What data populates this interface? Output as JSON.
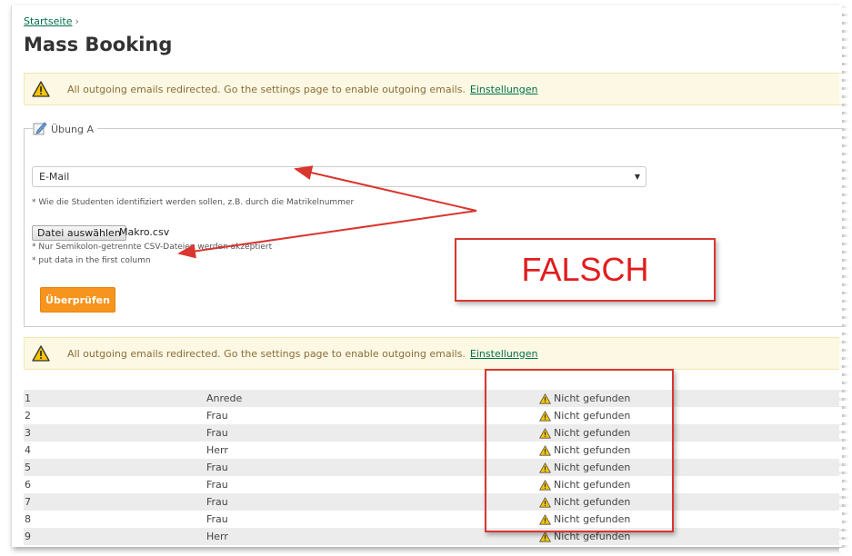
{
  "breadcrumb": {
    "home_label": "Startseite",
    "separator": "›"
  },
  "page_title": "Mass Booking",
  "alert": {
    "message": "All outgoing emails redirected. Go the settings page to enable outgoing emails.",
    "link_label": "Einstellungen"
  },
  "form": {
    "legend": "Übung A",
    "identifier_select": {
      "value": "E-Mail"
    },
    "identifier_hint": "* Wie die Studenten identifiziert werden sollen, z.B. durch die Matrikelnummer",
    "file_button_label": "Datei auswählen",
    "file_name": "Makro.csv",
    "file_hint_1": "* Nur Semikolon-getrennte CSV-Dateien werden akzeptiert",
    "file_hint_2": "* put data in the first column",
    "submit_label": "Überprüfen"
  },
  "annotation": {
    "label": "FALSCH",
    "color": "#e11d1d"
  },
  "results": [
    {
      "num": "1",
      "value": "Anrede",
      "status": "Nicht gefunden"
    },
    {
      "num": "2",
      "value": "Frau",
      "status": "Nicht gefunden"
    },
    {
      "num": "3",
      "value": "Frau",
      "status": "Nicht gefunden"
    },
    {
      "num": "4",
      "value": "Herr",
      "status": "Nicht gefunden"
    },
    {
      "num": "5",
      "value": "Frau",
      "status": "Nicht gefunden"
    },
    {
      "num": "6",
      "value": "Frau",
      "status": "Nicht gefunden"
    },
    {
      "num": "7",
      "value": "Frau",
      "status": "Nicht gefunden"
    },
    {
      "num": "8",
      "value": "Frau",
      "status": "Nicht gefunden"
    },
    {
      "num": "9",
      "value": "Herr",
      "status": "Nicht gefunden"
    }
  ],
  "colors": {
    "accent": "#f7941d",
    "link": "#00704a",
    "alert_bg": "#fcf8e3",
    "annotation": "#d9362f"
  }
}
